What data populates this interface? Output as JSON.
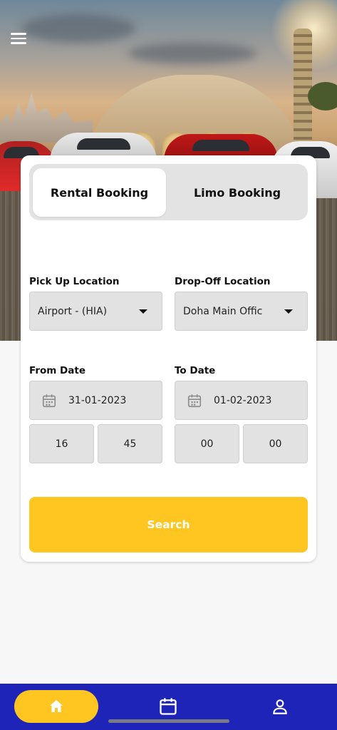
{
  "header": {
    "menu_icon": "hamburger-menu-icon"
  },
  "booking_tabs": {
    "rental": "Rental Booking",
    "limo": "Limo Booking",
    "active": "rental"
  },
  "form": {
    "pickup": {
      "label": "Pick Up Location",
      "value": "Airport - (HIA)"
    },
    "dropoff": {
      "label": "Drop-Off Location",
      "value": "Doha Main Offic"
    },
    "from_date": {
      "label": "From Date",
      "value": "31-01-2023",
      "hour": "16",
      "minute": "45"
    },
    "to_date": {
      "label": "To Date",
      "value": "01-02-2023",
      "hour": "00",
      "minute": "00"
    },
    "search_label": "Search"
  },
  "bottom_nav": {
    "items": [
      "home-icon",
      "calendar-icon",
      "user-icon"
    ],
    "active": "home"
  },
  "colors": {
    "accent": "#ffc621",
    "nav_background": "#1f24b8",
    "field_background": "#e2e2e2"
  }
}
